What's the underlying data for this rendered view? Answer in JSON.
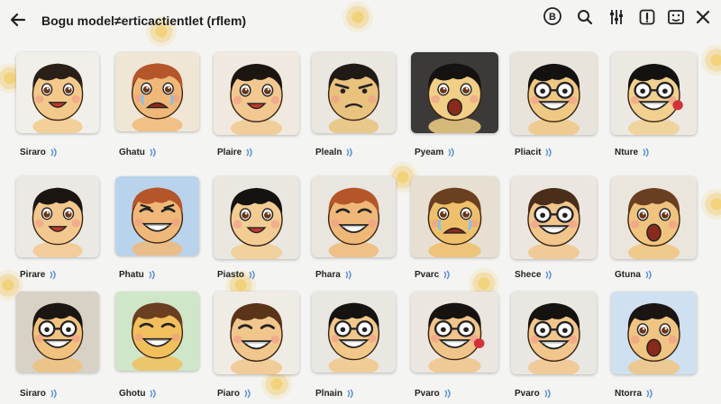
{
  "window": {
    "title": "Bogu model≠erticactientlet (rflem)"
  },
  "toolbar": {
    "icons": [
      "back-arrow-icon",
      "emoji-badge-icon",
      "search-icon",
      "tune-icon",
      "exclamation-icon",
      "emoji-keyboard-icon",
      "close-icon"
    ]
  },
  "stickers": [
    {
      "label": "Siraro",
      "bg": "#f1efe9",
      "face": "#f3c98b",
      "hair": "#2a2018",
      "mood": "smile"
    },
    {
      "label": "Ghatu",
      "bg": "#efe6d6",
      "face": "#f0b878",
      "hair": "#b5552a",
      "mood": "cry"
    },
    {
      "label": "Plaire",
      "bg": "#efe9df",
      "face": "#f2c890",
      "hair": "#1c1612",
      "mood": "happy"
    },
    {
      "label": "Plealn",
      "bg": "#e9e7df",
      "face": "#e9c27e",
      "hair": "#1f1a16",
      "mood": "grumpy"
    },
    {
      "label": "Pyeam",
      "bg": "#3c3a38",
      "face": "#f1cf86",
      "hair": "#151210",
      "mood": "shock"
    },
    {
      "label": "Pliacit",
      "bg": "#e8e4dc",
      "face": "#efc884",
      "hair": "#141210",
      "mood": "grin"
    },
    {
      "label": "Nture",
      "bg": "#ece9e2",
      "face": "#f1d090",
      "hair": "#141210",
      "mood": "sick"
    },
    {
      "label": "Pirare",
      "bg": "#ebe9e4",
      "face": "#f3c88e",
      "hair": "#1c1612",
      "mood": "smile"
    },
    {
      "label": "Phatu",
      "bg": "#b9d3ec",
      "face": "#f0b878",
      "hair": "#b5552a",
      "mood": "angry"
    },
    {
      "label": "Piasto",
      "bg": "#eae7e0",
      "face": "#f2cc92",
      "hair": "#151210",
      "mood": "happy"
    },
    {
      "label": "Phara",
      "bg": "#e9e6e0",
      "face": "#f0b878",
      "hair": "#b5552a",
      "mood": "laugh"
    },
    {
      "label": "Pvarc",
      "bg": "#e7dfd2",
      "face": "#efc06c",
      "hair": "#6a4020",
      "mood": "cry"
    },
    {
      "label": "Shece",
      "bg": "#ebe7e0",
      "face": "#f1c68c",
      "hair": "#4a2e1a",
      "mood": "grin"
    },
    {
      "label": "Gtuna",
      "bg": "#ebe6dd",
      "face": "#f0c47e",
      "hair": "#6a3e20",
      "mood": "shock"
    },
    {
      "label": "Siraro",
      "bg": "#d8d2c6",
      "face": "#f0c27e",
      "hair": "#1c1612",
      "mood": "grin"
    },
    {
      "label": "Ghotu",
      "bg": "#cfe6c8",
      "face": "#f1bf5c",
      "hair": "#6a3e20",
      "mood": "laugh"
    },
    {
      "label": "Piaro",
      "bg": "#efebe5",
      "face": "#f1c68c",
      "hair": "#5a3418",
      "mood": "laugh"
    },
    {
      "label": "Plnain",
      "bg": "#e9e7e2",
      "face": "#f1c88a",
      "hair": "#151210",
      "mood": "grin"
    },
    {
      "label": "Pvaro",
      "bg": "#ebe6df",
      "face": "#f0c48a",
      "hair": "#151210",
      "mood": "sick"
    },
    {
      "label": "Pvaro",
      "bg": "#e9e7e2",
      "face": "#f1c68c",
      "hair": "#151210",
      "mood": "grin"
    },
    {
      "label": "Ntorra",
      "bg": "#cfe0f0",
      "face": "#f0c482",
      "hair": "#1a1512",
      "mood": "shock"
    }
  ]
}
